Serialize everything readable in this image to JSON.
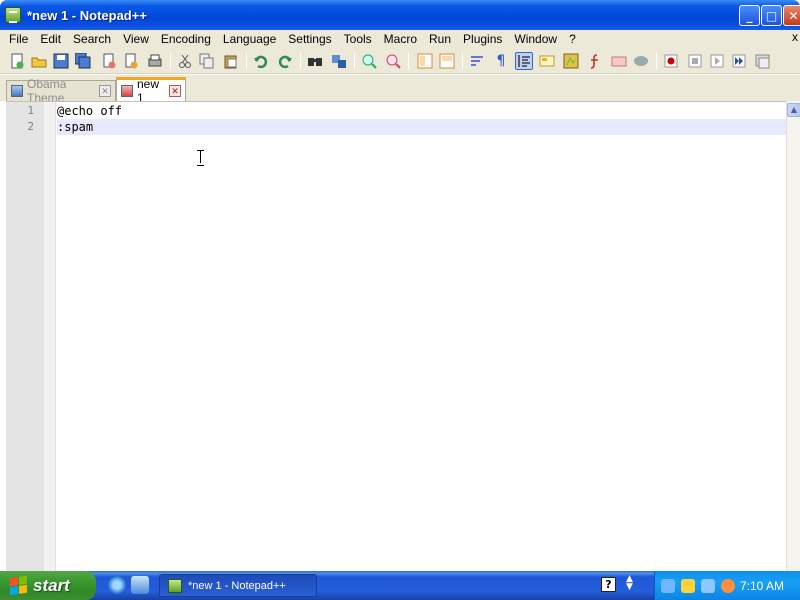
{
  "window": {
    "title": "*new 1 - Notepad++",
    "controls": {
      "minimize": "_",
      "maximize": "□",
      "close": "✕"
    }
  },
  "menubar": {
    "items": [
      "File",
      "Edit",
      "Search",
      "View",
      "Encoding",
      "Language",
      "Settings",
      "Tools",
      "Macro",
      "Run",
      "Plugins",
      "Window",
      "?"
    ],
    "close_glyph": "x"
  },
  "toolbar": {
    "icons": [
      "new-file-icon",
      "open-file-icon",
      "save-icon",
      "save-all-icon",
      "close-icon",
      "close-all-icon",
      "print-icon",
      "cut-icon",
      "copy-icon",
      "paste-icon",
      "undo-icon",
      "redo-icon",
      "find-icon",
      "replace-icon",
      "zoom-in-icon",
      "zoom-out-icon",
      "sync-vertical-icon",
      "sync-horizontal-icon",
      "word-wrap-icon",
      "show-all-chars-icon",
      "indent-guide-icon",
      "user-lang-icon",
      "doc-map-icon",
      "function-list-icon",
      "folder-workspace-icon",
      "monitoring-icon",
      "record-macro-icon",
      "stop-record-icon",
      "play-macro-icon",
      "run-macro-multiple-icon",
      "save-macro-icon"
    ],
    "pressed": "indent-guide-icon"
  },
  "tabs": [
    {
      "label": "Obama Theme",
      "active": false
    },
    {
      "label": "new 1",
      "active": true
    }
  ],
  "editor": {
    "lines": [
      {
        "number": "1",
        "text": "@echo off"
      },
      {
        "number": "2",
        "text": ":spam"
      }
    ],
    "current_line": 2
  },
  "taskbar": {
    "start_label": "start",
    "task_label": "*new 1 - Notepad++",
    "help_glyph": "?",
    "clock": "7:10 AM"
  },
  "colors": {
    "title_blue": "#0a58e6",
    "chrome": "#ece9d8",
    "tab_accent": "#f5a623",
    "current_line": "#e8e8ff",
    "start_green": "#3d9b34"
  }
}
